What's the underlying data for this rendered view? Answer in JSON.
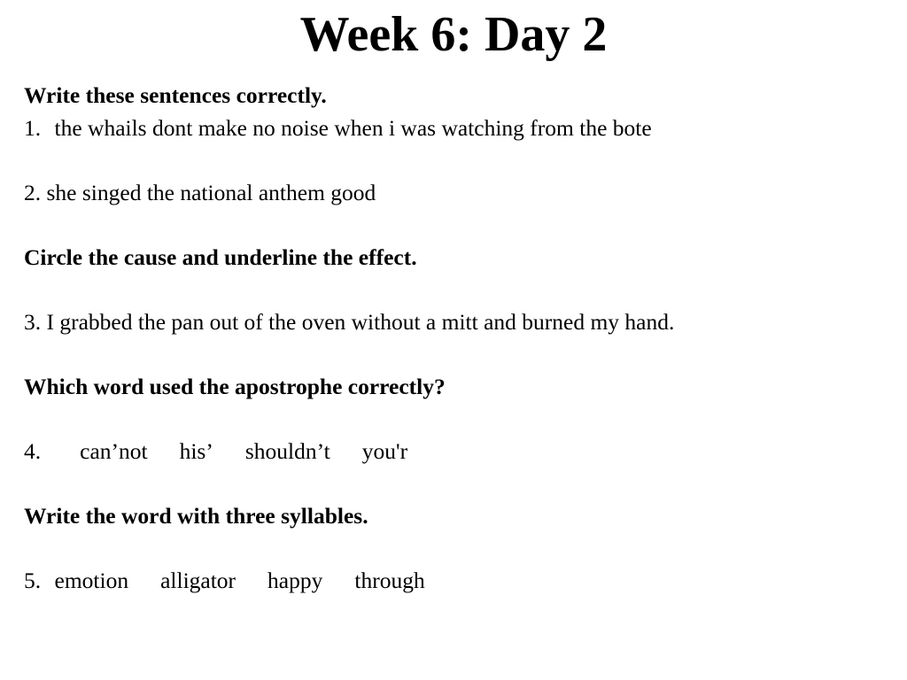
{
  "slide": {
    "title": "Week 6: Day 2",
    "background_color": "#ffffff",
    "text_color": "#000000"
  },
  "content": {
    "heading_1": "Write these sentences correctly.",
    "item_1_number": "1.",
    "item_1_text": "the whails dont make no noise when i was watching from the bote",
    "item_2_number": "2.",
    "item_2_text": "she singed the national anthem good",
    "heading_2": "Circle the cause and underline the effect.",
    "item_3_number": "3.",
    "item_3_text": "I grabbed the pan out of the oven without a mitt and burned my hand.",
    "heading_3": "Which word used the apostrophe correctly?",
    "item_4_number": "4.",
    "item_4_choices": [
      "can’not",
      "his’",
      "shouldn’t",
      "you'r"
    ],
    "heading_4": "Write the word with three syllables.",
    "item_5_number": "5.",
    "item_5_choices": [
      "emotion",
      "alligator",
      "happy",
      "through"
    ]
  }
}
